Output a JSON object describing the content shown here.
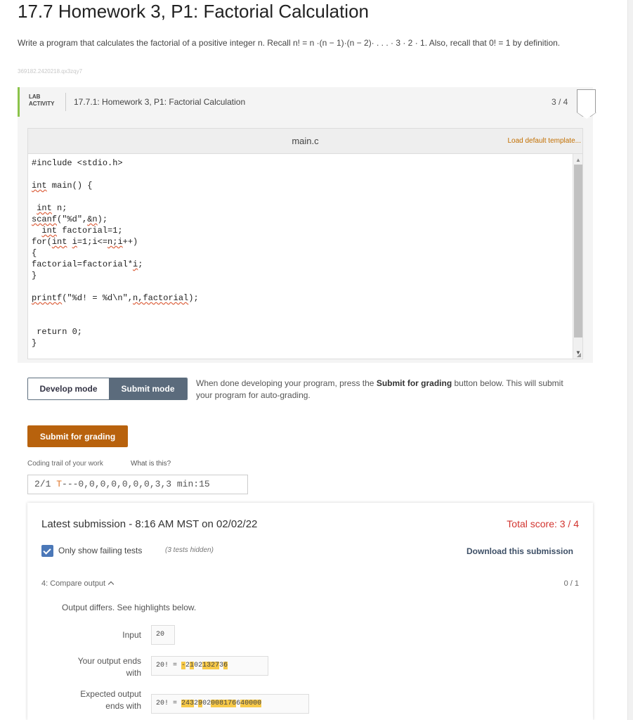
{
  "page": {
    "title": "17.7 Homework 3, P1: Factorial Calculation",
    "prompt": "Write a program that calculates the factorial of a positive integer n. Recall n! = n ·(n − 1)·(n − 2)· . . . · 3 · 2 · 1. Also, recall that 0! = 1 by definition.",
    "resource_id": "369182.2420218.qx3zqy7"
  },
  "lab": {
    "tag_line1": "LAB",
    "tag_line2": "ACTIVITY",
    "title": "17.7.1: Homework 3, P1: Factorial Calculation",
    "score": "3 / 4",
    "accent_color": "#8bc34a"
  },
  "editor": {
    "file_name": "main.c",
    "load_default": "Load default template...",
    "code_lines": [
      "#include <stdio.h>",
      "",
      "int main() {",
      "",
      " int n;",
      "scanf(\"%d\",&n);",
      "  int factorial=1;",
      "for(int i=1;i<=n;i++)",
      "{",
      "factorial=factorial*i;",
      "}",
      "",
      "printf(\"%d! = %d\\n\",n,factorial);",
      "",
      "",
      " return 0;",
      "}"
    ]
  },
  "modes": {
    "develop_label": "Develop mode",
    "submit_label": "Submit mode",
    "active": "Submit mode",
    "note_pre": "When done developing your program, press the ",
    "note_bold": "Submit for grading",
    "note_post": " button below. This will submit your program for auto-grading."
  },
  "submit": {
    "label": "Submit for grading",
    "color": "#b8620d"
  },
  "trail": {
    "label": "Coding trail of your work",
    "help": "What is this?",
    "prefix": "2/1 ",
    "t_marker": "T",
    "rest": "---0,0,0,0,0,0,0,3,3 min:15"
  },
  "results": {
    "submission_time": "Latest submission - 8:16 AM MST on 02/02/22",
    "total_score": "Total score: 3 / 4",
    "only_failing_label": "Only show failing tests",
    "only_failing_checked": true,
    "hidden_tests": "(3 tests hidden)",
    "download_label": "Download this submission",
    "test": {
      "header": "4: Compare output",
      "score": "0 / 1",
      "message": "Output differs. See highlights below.",
      "input_label": "Input",
      "input_value": "20",
      "your_output_label_1": "Your output ends",
      "your_output_label_2": "with",
      "your_output_prefix": "20! = ",
      "your_output_value": "-2102132736",
      "expected_label_1": "Expected output",
      "expected_label_2": "ends with",
      "expected_prefix": "20! = ",
      "expected_value": "2432902008176640000"
    }
  }
}
